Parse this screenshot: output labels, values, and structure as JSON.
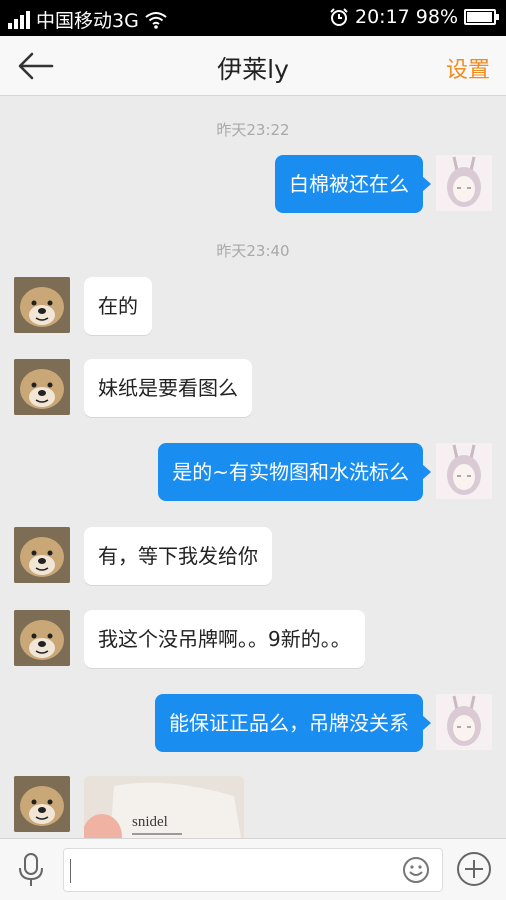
{
  "status_bar": {
    "carrier": "中国移动3G",
    "time": "20:17",
    "battery": "98%",
    "battery_level": 0.98,
    "icons": [
      "signal-icon",
      "wifi-icon",
      "alarm-icon",
      "battery-icon"
    ]
  },
  "header": {
    "title": "伊莱ly",
    "settings_label": "设置",
    "accent_color": "#f08c1e",
    "icons": [
      "back-arrow-icon"
    ]
  },
  "chat": {
    "timestamps": [
      "昨天23:22",
      "昨天23:40"
    ],
    "messages": [
      {
        "side": "out",
        "text": "白棉被还在么"
      },
      {
        "side": "in",
        "text": "在的"
      },
      {
        "side": "in",
        "text": "妹纸是要看图么"
      },
      {
        "side": "out",
        "text": "是的~有实物图和水洗标么"
      },
      {
        "side": "in",
        "text": "有，等下我发给你"
      },
      {
        "side": "in",
        "text": "我这个没吊牌啊。。9新的。。"
      },
      {
        "side": "out",
        "text": "能保证正品么，吊牌没关系"
      },
      {
        "side": "in",
        "image": true,
        "image_label": "snidel"
      }
    ],
    "bubble_color_out": "#1a8ef0",
    "bubble_color_in": "#ffffff"
  },
  "input_bar": {
    "placeholder": "",
    "icons": [
      "microphone-icon",
      "emoji-icon",
      "plus-icon"
    ]
  }
}
